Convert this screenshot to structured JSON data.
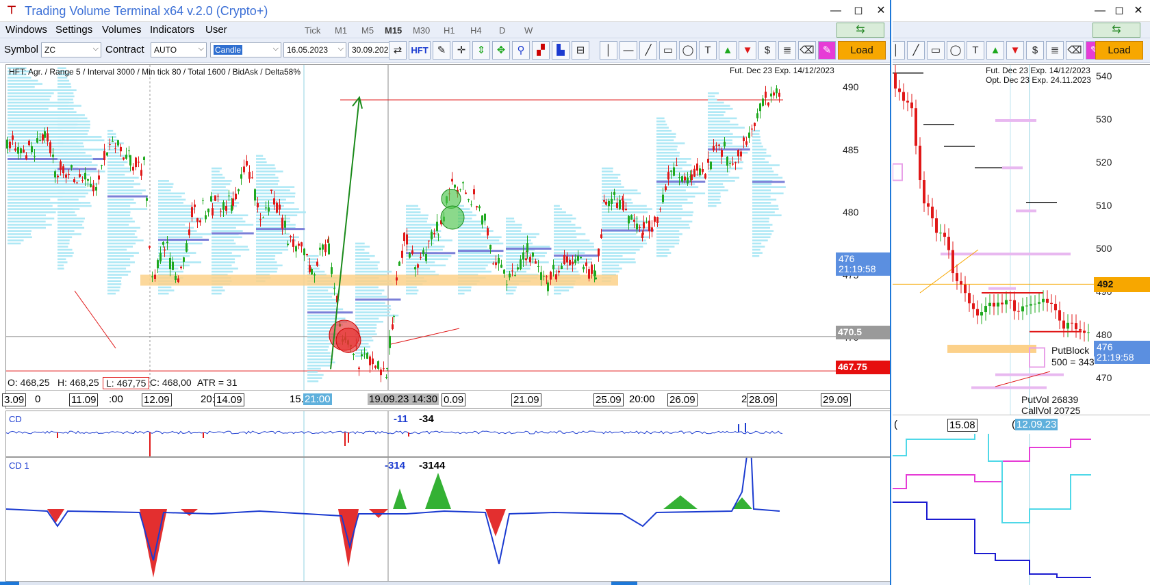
{
  "app": {
    "title": "Trading Volume Terminal x64 v.2.0 (Crypto+)",
    "window_buttons": [
      "—",
      "◻",
      "✕"
    ]
  },
  "menu": [
    "Windows",
    "Settings",
    "Volumes",
    "Indicators",
    "User"
  ],
  "timeframes": [
    "Tick",
    "M1",
    "M5",
    "M15",
    "M30",
    "H1",
    "H4",
    "D",
    "W"
  ],
  "active_timeframe": "M15",
  "toolbar": {
    "symbol_label": "Symbol",
    "symbol_value": "ZC",
    "contract_label": "Contract",
    "contract_value": "AUTO",
    "charttype_value": "Candle",
    "date_from": "16.05.2023",
    "date_to": "30.09.2023",
    "hft_label": "HFT",
    "load_label": "Load"
  },
  "main_chart": {
    "header": "HFT: Agr. / Range 5 / Interval 3000 / Min tick 80 / Total 1600 / BidAsk / Delta58%",
    "contract_info": "Fut. Dec 23 Exp. 14/12/2023",
    "price_ticks": [
      "490",
      "485",
      "480",
      "475",
      "470"
    ],
    "last_price": "476",
    "timer": "21:19:58",
    "level1": "470.5",
    "level2": "467.75",
    "ohlc": {
      "o": "O: 468,25",
      "h": "H: 468,25",
      "l": "L: 467,75",
      "c": "C: 468,00",
      "atr": "ATR = 31"
    },
    "date_labels": [
      "3.09",
      "0",
      "11.09",
      ":00",
      "12.09",
      "20:",
      "14.09",
      "15.",
      "21:00",
      "19.09.23 14:30",
      "0.09",
      "21.09",
      "25.09",
      "20:00",
      "26.09",
      "2",
      "28.09",
      "29.09"
    ]
  },
  "cd_panel": {
    "title": "CD",
    "value1": "-11",
    "value2": "-34"
  },
  "cd1_panel": {
    "title": "CD 1",
    "value1": "-314",
    "value2": "-3144"
  },
  "side_chart": {
    "contract_info1": "Fut. Dec 23 Exp. 14/12/2023",
    "contract_info2": "Opt. Dec 23 Exp. 24.11.2023",
    "price_ticks": [
      "540",
      "530",
      "520",
      "510",
      "500",
      "490",
      "480",
      "470"
    ],
    "marked_price": "492",
    "last_price": "476",
    "timer": "21:19:58",
    "putblock_label": "PutBlock",
    "putblock_value": "500 = 343",
    "putvol": "PutVol  26839",
    "callvol": "CallVol  20725",
    "date_labels": [
      "(",
      "15.08",
      "(",
      "12.09.23"
    ]
  },
  "colors": {
    "accent": "#1e78d8",
    "bull": "#1ea81e",
    "bear": "#e01818",
    "profile": "#aee8f5",
    "profile_poc": "#7b7fd8",
    "level_band": "#fcd18a",
    "load_button": "#f7a700",
    "price_tag": "#5b8fe0"
  }
}
